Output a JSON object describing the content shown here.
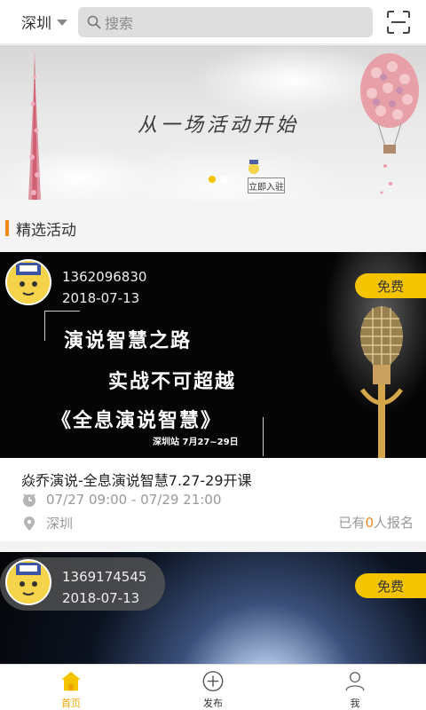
{
  "topbar": {
    "city": "深圳",
    "search_placeholder": "搜索"
  },
  "banner": {
    "slogan": "从一场活动开始",
    "join_label": "立即入驻",
    "dots": [
      {
        "active": true
      },
      {
        "active": false
      }
    ]
  },
  "section": {
    "title": "精选活动"
  },
  "activities": [
    {
      "owner_phone": "1362096830",
      "owner_date": "2018-07-13",
      "price_badge": "免费",
      "poster_line1": "演说智慧之路",
      "poster_line2": "实战不可超越",
      "poster_line3": "《全息演说智慧》",
      "poster_date": "深圳站 7月27~29日",
      "title": "焱乔演说-全息演说智慧7.27-29开课",
      "time": "07/27 09:00 - 07/29 21:00",
      "location": "深圳",
      "enroll_prefix": "已有",
      "enroll_count": "0",
      "enroll_suffix": "人报名"
    },
    {
      "owner_phone": "1369174545",
      "owner_date": "2018-07-13",
      "price_badge": "免费"
    }
  ],
  "tabbar": {
    "items": [
      {
        "label": "首页",
        "icon": "home-icon",
        "active": true
      },
      {
        "label": "发布",
        "icon": "plus-circle-icon",
        "active": false
      },
      {
        "label": "我",
        "icon": "user-icon",
        "active": false
      }
    ]
  },
  "colors": {
    "accent": "#f0a400",
    "badge": "#f5c400",
    "section_bar": "#f08a1c",
    "enroll_count": "#f08a1c"
  }
}
